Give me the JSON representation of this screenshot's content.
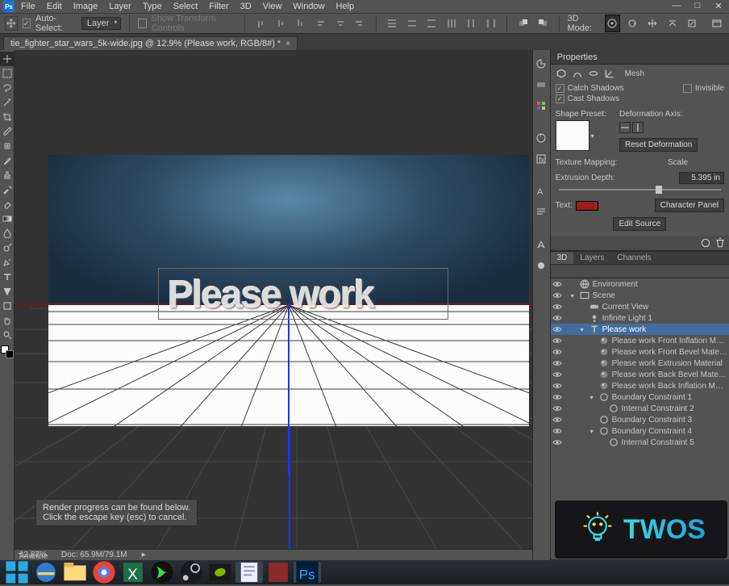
{
  "app": {
    "icon_label": "Ps"
  },
  "menubar": [
    "File",
    "Edit",
    "Image",
    "Layer",
    "Type",
    "Select",
    "Filter",
    "3D",
    "View",
    "Window",
    "Help"
  ],
  "window_buttons": {
    "min": "—",
    "restore": "□",
    "close": "✕"
  },
  "options": {
    "auto_select_label": "Auto-Select:",
    "auto_select_checked": true,
    "target": "Layer",
    "show_transform_label": "Show Transform Controls",
    "show_transform_checked": false,
    "mode3d_label": "3D Mode:"
  },
  "document": {
    "tab_title": "tie_fighter_star_wars_5k-wide.jpg @ 12.9% (Please work, RGB/8#) *",
    "tab_close": "×"
  },
  "canvas": {
    "text3d": "Please work",
    "tooltip_l1": "Render progress can be found below.",
    "tooltip_l2": "Click the escape key (esc) to cancel."
  },
  "status": {
    "zoom": "12.87%",
    "doc_label": "Doc:",
    "doc_value": "65.9M/79.1M",
    "caret": "▸",
    "timeline_label": "Timeline"
  },
  "properties": {
    "title": "Properties",
    "mesh_label": "Mesh",
    "catch_shadows": "Catch Shadows",
    "catch_checked": true,
    "cast_shadows": "Cast Shadows",
    "cast_checked": true,
    "invisible_label": "Invisible",
    "invisible_checked": false,
    "shape_preset": "Shape Preset:",
    "deform_axis": "Deformation Axis:",
    "reset_btn": "Reset Deformation",
    "tex_map_label": "Texture Mapping:",
    "tex_map_value": "Scale",
    "extrusion_label": "Extrusion Depth:",
    "extrusion_value": "5.395 in",
    "text_label": "Text:",
    "color": "#9a1e1e",
    "char_panel": "Character Panel",
    "edit_source": "Edit Source"
  },
  "tabs3d": [
    "3D",
    "Layers",
    "Channels"
  ],
  "tabs3d_active": 0,
  "tree": [
    {
      "indent": 0,
      "icon": "globe",
      "label": "Environment",
      "eye": true,
      "type": "leaf"
    },
    {
      "indent": 0,
      "icon": "scene",
      "label": "Scene",
      "eye": true,
      "type": "open"
    },
    {
      "indent": 1,
      "icon": "camera",
      "label": "Current View",
      "eye": true,
      "type": "leaf"
    },
    {
      "indent": 1,
      "icon": "light",
      "label": "Infinite Light 1",
      "eye": true,
      "type": "leaf"
    },
    {
      "indent": 1,
      "icon": "text",
      "label": "Please work",
      "eye": true,
      "type": "open",
      "selected": true
    },
    {
      "indent": 2,
      "icon": "material",
      "label": "Please work Front Inflation M…",
      "eye": true,
      "type": "leaf"
    },
    {
      "indent": 2,
      "icon": "material",
      "label": "Please work Front Bevel Mate…",
      "eye": true,
      "type": "leaf"
    },
    {
      "indent": 2,
      "icon": "material",
      "label": "Please work Extrusion Material",
      "eye": true,
      "type": "leaf"
    },
    {
      "indent": 2,
      "icon": "material",
      "label": "Please work Back Bevel Mate…",
      "eye": true,
      "type": "leaf"
    },
    {
      "indent": 2,
      "icon": "material",
      "label": "Please work Back Inflation M…",
      "eye": true,
      "type": "leaf"
    },
    {
      "indent": 2,
      "icon": "constraint",
      "label": "Boundary Constraint 1",
      "eye": true,
      "type": "open"
    },
    {
      "indent": 3,
      "icon": "constraint",
      "label": "Internal Constraint 2",
      "eye": true,
      "type": "leaf"
    },
    {
      "indent": 2,
      "icon": "constraint",
      "label": "Boundary Constraint 3",
      "eye": true,
      "type": "leaf"
    },
    {
      "indent": 2,
      "icon": "constraint",
      "label": "Boundary Constraint 4",
      "eye": true,
      "type": "open"
    },
    {
      "indent": 3,
      "icon": "constraint",
      "label": "Internal Constraint 5",
      "eye": true,
      "type": "leaf"
    }
  ],
  "watermark": {
    "text": "TWOS"
  }
}
